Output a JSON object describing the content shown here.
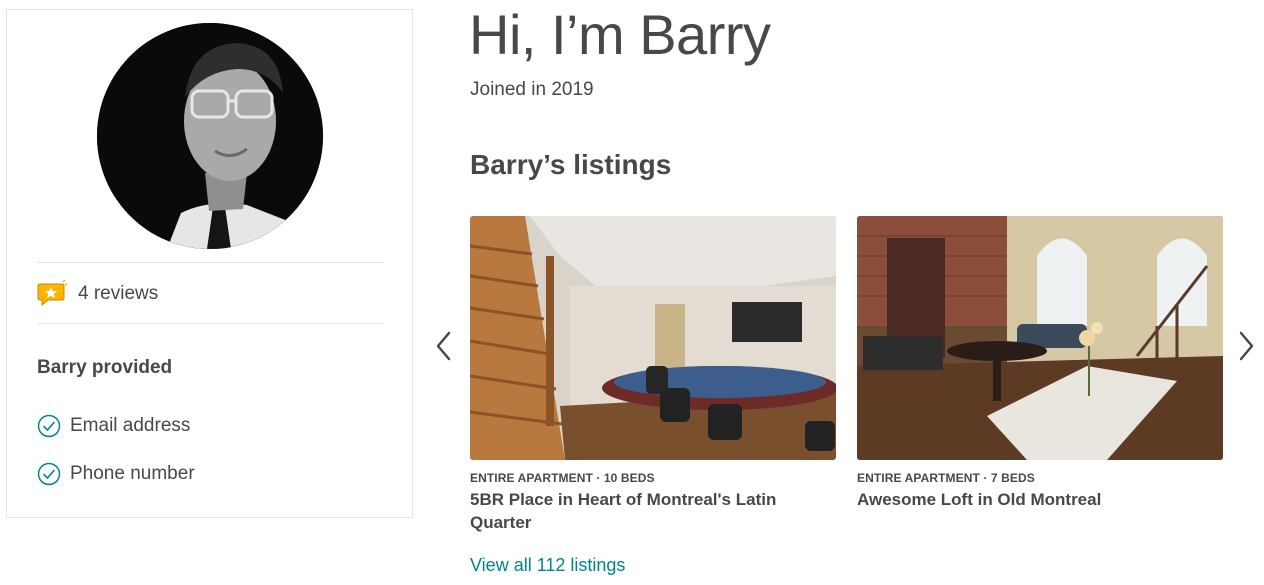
{
  "profile": {
    "reviews_label": "4 reviews",
    "provided_title": "Barry provided",
    "verifications": [
      {
        "label": "Email address",
        "icon": "check-circle-icon"
      },
      {
        "label": "Phone number",
        "icon": "check-circle-icon"
      }
    ]
  },
  "header": {
    "greeting": "Hi, I’m Barry",
    "joined": "Joined in 2019"
  },
  "listings": {
    "title": "Barry’s listings",
    "items": [
      {
        "meta": "ENTIRE APARTMENT · 10 BEDS",
        "name": "5BR Place in Heart of Montreal's Latin Quarter"
      },
      {
        "meta": "ENTIRE APARTMENT · 7 BEDS",
        "name": "Awesome Loft in Old Montreal"
      }
    ],
    "view_all": "View all 112 listings"
  },
  "colors": {
    "text": "#484848",
    "link": "#008489",
    "check": "#008489",
    "divider": "#e4e4e4"
  }
}
